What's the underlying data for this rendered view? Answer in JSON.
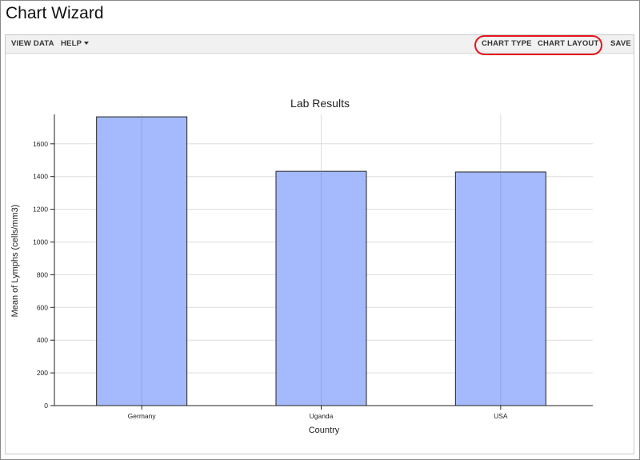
{
  "page": {
    "title": "Chart Wizard"
  },
  "toolbar": {
    "view_data": "VIEW DATA",
    "help": "HELP",
    "chart_type": "CHART TYPE",
    "chart_layout": "CHART LAYOUT",
    "save": "SAVE"
  },
  "colors": {
    "bar_fill": "#9bb2fc",
    "bar_stroke": "#222222",
    "highlight": "#e8141c"
  },
  "chart_data": {
    "type": "bar",
    "title": "Lab Results",
    "xlabel": "Country",
    "ylabel": "Mean of Lymphs (cells/mm3)",
    "categories": [
      "Germany",
      "Uganda",
      "USA"
    ],
    "values": [
      1765,
      1432,
      1428
    ],
    "ylim": [
      0,
      1780
    ],
    "yticks": [
      0,
      200,
      400,
      600,
      800,
      1000,
      1200,
      1400,
      1600
    ],
    "grid": true
  }
}
